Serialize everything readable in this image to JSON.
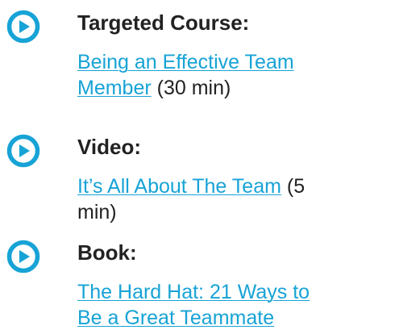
{
  "colors": {
    "accent": "#17a3d6",
    "text": "#222222"
  },
  "items": [
    {
      "icon": "play-circle-icon",
      "title": "Targeted Course:",
      "link_text": "Being an Effective Team Member",
      "suffix": " (30 min)"
    },
    {
      "icon": "play-circle-icon",
      "title": "Video:",
      "link_text": "It’s All About The Team",
      "suffix": " (5 min)"
    },
    {
      "icon": "play-circle-icon",
      "title": "Book:",
      "link_text": "The Hard Hat: 21 Ways to Be a Great Teammate",
      "suffix": ""
    }
  ]
}
